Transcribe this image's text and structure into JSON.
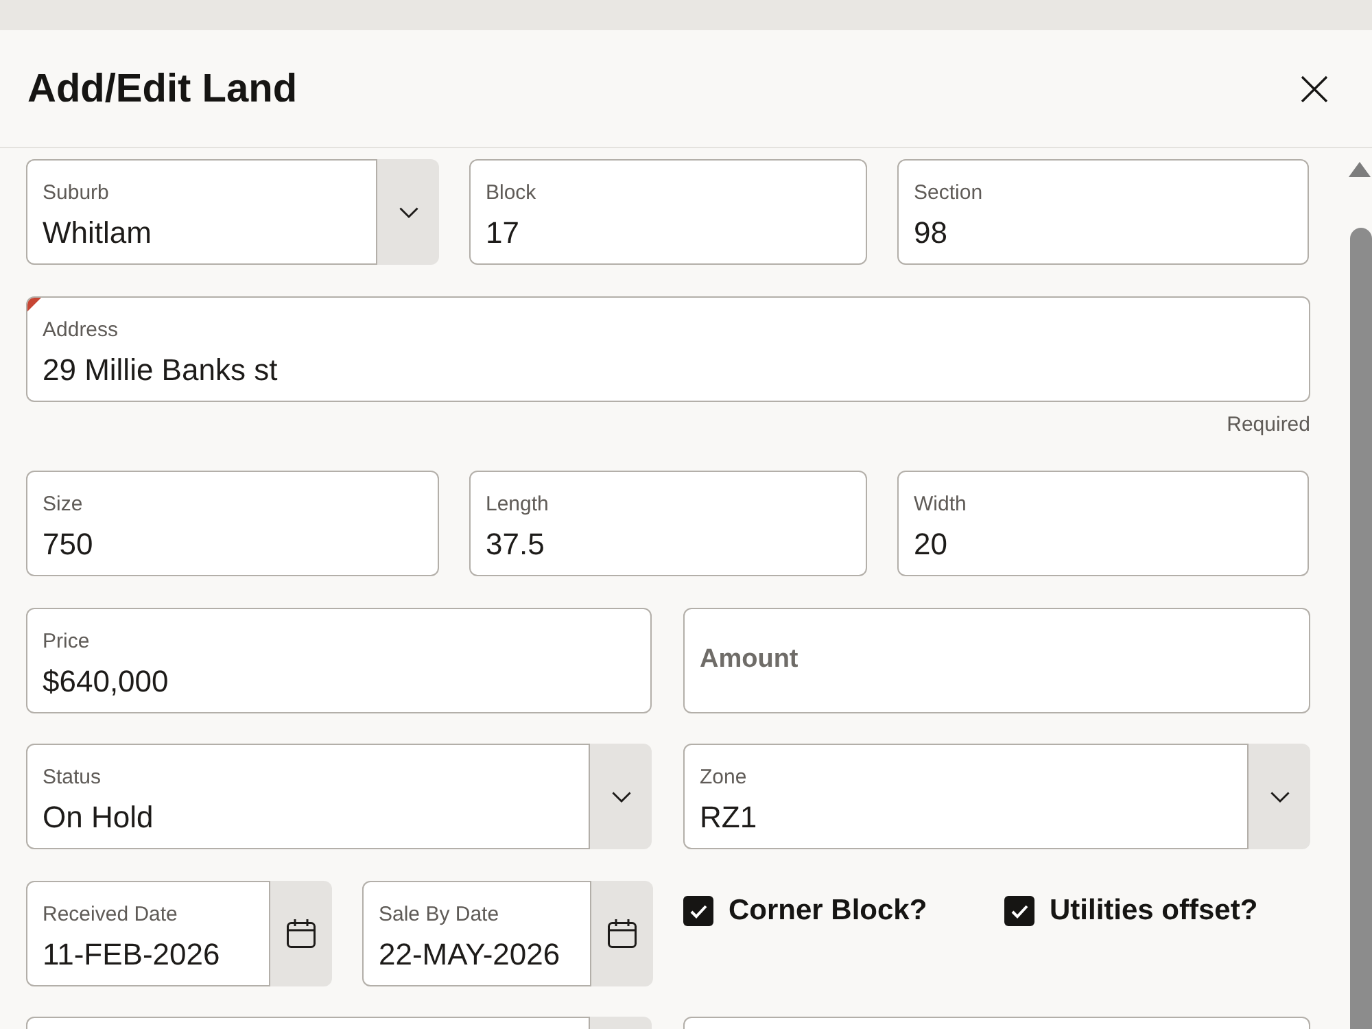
{
  "dialog": {
    "title": "Add/Edit Land"
  },
  "rows": [
    {
      "fields": [
        {
          "kind": "select",
          "label": "Suburb",
          "value": "Whitlam",
          "required": false
        },
        {
          "kind": "text",
          "label": "Block",
          "value": "17",
          "required": false
        },
        {
          "kind": "text",
          "label": "Section",
          "value": "98",
          "required": false
        }
      ]
    },
    {
      "fields": [
        {
          "kind": "text",
          "label": "Address",
          "value": "29 Millie Banks st",
          "required": true,
          "helper": "Required"
        }
      ]
    },
    {
      "fields": [
        {
          "kind": "text",
          "label": "Size",
          "value": "750",
          "required": false
        },
        {
          "kind": "text",
          "label": "Length",
          "value": "37.5",
          "required": false
        },
        {
          "kind": "text",
          "label": "Width",
          "value": "20",
          "required": false
        }
      ]
    },
    {
      "fields": [
        {
          "kind": "text",
          "label": "Price",
          "value": "$640,000",
          "required": false
        },
        {
          "kind": "text",
          "placeholder": "Amount",
          "required": false
        }
      ]
    },
    {
      "fields": [
        {
          "kind": "select",
          "label": "Status",
          "value": "On Hold",
          "required": false
        },
        {
          "kind": "select",
          "label": "Zone",
          "value": "RZ1",
          "required": false
        }
      ]
    },
    {
      "fields": [
        {
          "kind": "date",
          "label": "Received Date",
          "value": "11-FEB-2026",
          "required": false
        },
        {
          "kind": "date",
          "label": "Sale By Date",
          "value": "22-MAY-2026",
          "required": false
        },
        {
          "kind": "checkbox",
          "label": "Corner Block?",
          "checked": true
        },
        {
          "kind": "checkbox",
          "label": "Utilities offset?",
          "checked": true
        }
      ]
    },
    {
      "fields": [
        {
          "kind": "select",
          "required": false
        },
        {
          "kind": "text",
          "required": false
        }
      ]
    }
  ]
}
